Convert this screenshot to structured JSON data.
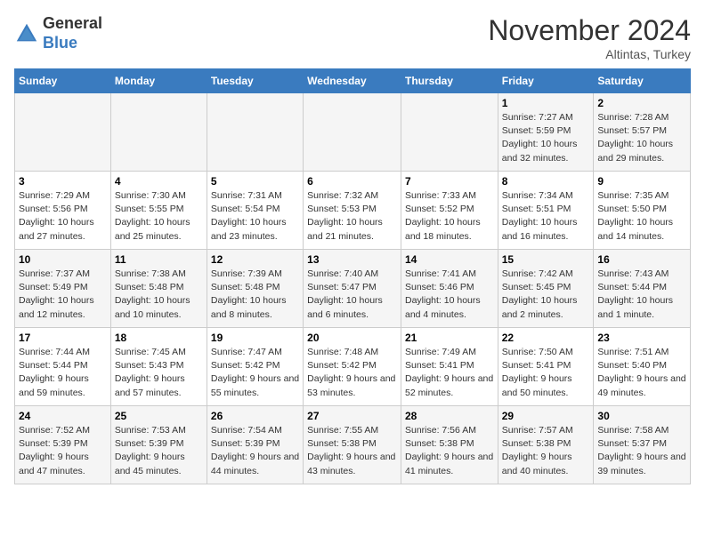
{
  "header": {
    "logo_general": "General",
    "logo_blue": "Blue",
    "month": "November 2024",
    "location": "Altintas, Turkey"
  },
  "days_of_week": [
    "Sunday",
    "Monday",
    "Tuesday",
    "Wednesday",
    "Thursday",
    "Friday",
    "Saturday"
  ],
  "weeks": [
    [
      {
        "day": "",
        "info": ""
      },
      {
        "day": "",
        "info": ""
      },
      {
        "day": "",
        "info": ""
      },
      {
        "day": "",
        "info": ""
      },
      {
        "day": "",
        "info": ""
      },
      {
        "day": "1",
        "info": "Sunrise: 7:27 AM\nSunset: 5:59 PM\nDaylight: 10 hours and 32 minutes."
      },
      {
        "day": "2",
        "info": "Sunrise: 7:28 AM\nSunset: 5:57 PM\nDaylight: 10 hours and 29 minutes."
      }
    ],
    [
      {
        "day": "3",
        "info": "Sunrise: 7:29 AM\nSunset: 5:56 PM\nDaylight: 10 hours and 27 minutes."
      },
      {
        "day": "4",
        "info": "Sunrise: 7:30 AM\nSunset: 5:55 PM\nDaylight: 10 hours and 25 minutes."
      },
      {
        "day": "5",
        "info": "Sunrise: 7:31 AM\nSunset: 5:54 PM\nDaylight: 10 hours and 23 minutes."
      },
      {
        "day": "6",
        "info": "Sunrise: 7:32 AM\nSunset: 5:53 PM\nDaylight: 10 hours and 21 minutes."
      },
      {
        "day": "7",
        "info": "Sunrise: 7:33 AM\nSunset: 5:52 PM\nDaylight: 10 hours and 18 minutes."
      },
      {
        "day": "8",
        "info": "Sunrise: 7:34 AM\nSunset: 5:51 PM\nDaylight: 10 hours and 16 minutes."
      },
      {
        "day": "9",
        "info": "Sunrise: 7:35 AM\nSunset: 5:50 PM\nDaylight: 10 hours and 14 minutes."
      }
    ],
    [
      {
        "day": "10",
        "info": "Sunrise: 7:37 AM\nSunset: 5:49 PM\nDaylight: 10 hours and 12 minutes."
      },
      {
        "day": "11",
        "info": "Sunrise: 7:38 AM\nSunset: 5:48 PM\nDaylight: 10 hours and 10 minutes."
      },
      {
        "day": "12",
        "info": "Sunrise: 7:39 AM\nSunset: 5:48 PM\nDaylight: 10 hours and 8 minutes."
      },
      {
        "day": "13",
        "info": "Sunrise: 7:40 AM\nSunset: 5:47 PM\nDaylight: 10 hours and 6 minutes."
      },
      {
        "day": "14",
        "info": "Sunrise: 7:41 AM\nSunset: 5:46 PM\nDaylight: 10 hours and 4 minutes."
      },
      {
        "day": "15",
        "info": "Sunrise: 7:42 AM\nSunset: 5:45 PM\nDaylight: 10 hours and 2 minutes."
      },
      {
        "day": "16",
        "info": "Sunrise: 7:43 AM\nSunset: 5:44 PM\nDaylight: 10 hours and 1 minute."
      }
    ],
    [
      {
        "day": "17",
        "info": "Sunrise: 7:44 AM\nSunset: 5:44 PM\nDaylight: 9 hours and 59 minutes."
      },
      {
        "day": "18",
        "info": "Sunrise: 7:45 AM\nSunset: 5:43 PM\nDaylight: 9 hours and 57 minutes."
      },
      {
        "day": "19",
        "info": "Sunrise: 7:47 AM\nSunset: 5:42 PM\nDaylight: 9 hours and 55 minutes."
      },
      {
        "day": "20",
        "info": "Sunrise: 7:48 AM\nSunset: 5:42 PM\nDaylight: 9 hours and 53 minutes."
      },
      {
        "day": "21",
        "info": "Sunrise: 7:49 AM\nSunset: 5:41 PM\nDaylight: 9 hours and 52 minutes."
      },
      {
        "day": "22",
        "info": "Sunrise: 7:50 AM\nSunset: 5:41 PM\nDaylight: 9 hours and 50 minutes."
      },
      {
        "day": "23",
        "info": "Sunrise: 7:51 AM\nSunset: 5:40 PM\nDaylight: 9 hours and 49 minutes."
      }
    ],
    [
      {
        "day": "24",
        "info": "Sunrise: 7:52 AM\nSunset: 5:39 PM\nDaylight: 9 hours and 47 minutes."
      },
      {
        "day": "25",
        "info": "Sunrise: 7:53 AM\nSunset: 5:39 PM\nDaylight: 9 hours and 45 minutes."
      },
      {
        "day": "26",
        "info": "Sunrise: 7:54 AM\nSunset: 5:39 PM\nDaylight: 9 hours and 44 minutes."
      },
      {
        "day": "27",
        "info": "Sunrise: 7:55 AM\nSunset: 5:38 PM\nDaylight: 9 hours and 43 minutes."
      },
      {
        "day": "28",
        "info": "Sunrise: 7:56 AM\nSunset: 5:38 PM\nDaylight: 9 hours and 41 minutes."
      },
      {
        "day": "29",
        "info": "Sunrise: 7:57 AM\nSunset: 5:38 PM\nDaylight: 9 hours and 40 minutes."
      },
      {
        "day": "30",
        "info": "Sunrise: 7:58 AM\nSunset: 5:37 PM\nDaylight: 9 hours and 39 minutes."
      }
    ]
  ]
}
